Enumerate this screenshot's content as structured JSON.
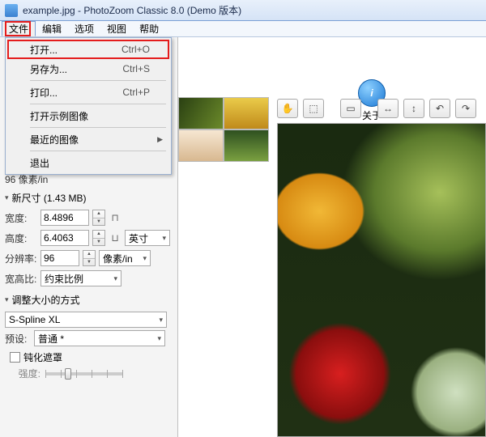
{
  "titlebar": {
    "text": "example.jpg - PhotoZoom Classic 8.0 (Demo 版本)"
  },
  "menubar": {
    "file": "文件",
    "edit": "编辑",
    "options": "选项",
    "view": "视图",
    "help": "帮助"
  },
  "file_menu": {
    "open": "打开...",
    "open_sc": "Ctrl+O",
    "saveas": "另存为...",
    "saveas_sc": "Ctrl+S",
    "print": "打印...",
    "print_sc": "Ctrl+P",
    "open_example": "打开示例图像",
    "recent": "最近的图像",
    "exit": "退出"
  },
  "toolbar": {
    "about": "关于",
    "about_glyph": "i"
  },
  "panel": {
    "dpi_line": "96 像素/in",
    "new_size_header": "新尺寸 (1.43 MB)",
    "width_label": "宽度:",
    "width_val": "8.4896",
    "height_label": "高度:",
    "height_val": "6.4063",
    "unit_inch": "英寸",
    "res_label": "分辨率:",
    "res_val": "96",
    "res_unit": "像素/in",
    "aspect_label": "宽高比:",
    "aspect_val": "约束比例",
    "resize_method_header": "调整大小的方式",
    "method_val": "S-Spline XL",
    "preset_label": "预设:",
    "preset_val": "普通 *",
    "sharpen_label": "钝化遮罩",
    "strength_label": "强度:"
  },
  "right_tools": {
    "pan": "✋",
    "marquee": "⬚",
    "crop": "▭",
    "flip_h": "↔",
    "flip_v": "↕",
    "rot_l": "↶",
    "rot_r": "↷"
  }
}
